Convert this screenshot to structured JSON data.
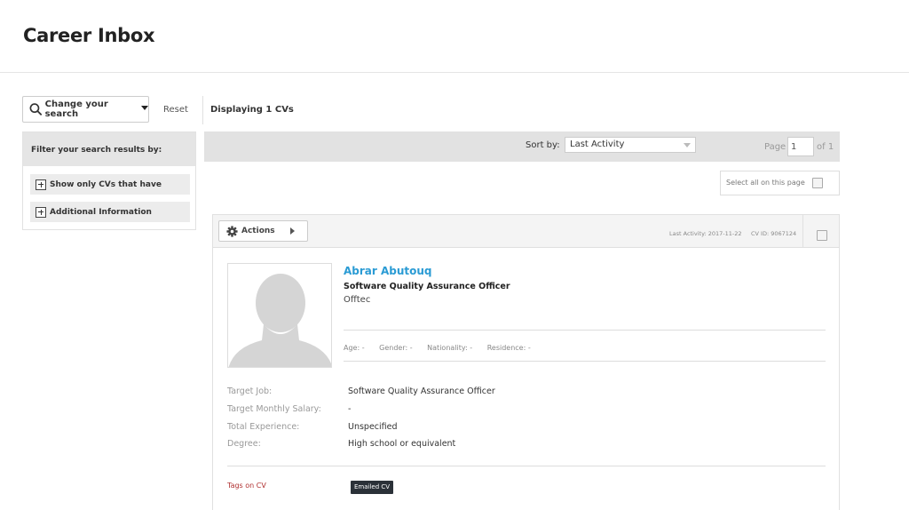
{
  "header": {
    "title": "Career Inbox"
  },
  "toolbar": {
    "change_search_label": "Change your search",
    "reset_label": "Reset",
    "displaying_text": "Displaying 1 CVs"
  },
  "filters": {
    "heading": "Filter your search results by:",
    "items": [
      {
        "label": "Show only CVs that have"
      },
      {
        "label": "Additional Information"
      }
    ]
  },
  "sort": {
    "label": "Sort by:",
    "selected": "Last Activity",
    "page_label": "Page",
    "page_value": "1",
    "page_total": "of 1"
  },
  "select_all": {
    "label": "Select all on this page",
    "checked": false
  },
  "cv": {
    "actions_label": "Actions",
    "last_activity": "Last Activity: 2017-11-22",
    "cv_id": "CV ID: 9067124",
    "name": "Abrar Abutouq",
    "title": "Software Quality Assurance Officer",
    "company": "Offtec",
    "demographics": {
      "age": "Age: -",
      "gender": "Gender: -",
      "nationality": "Nationality: -",
      "residence": "Residence: -"
    },
    "details": [
      {
        "label": "Target Job:",
        "value": "Software Quality Assurance Officer"
      },
      {
        "label": "Target Monthly Salary:",
        "value": "-"
      },
      {
        "label": "Total Experience:",
        "value": "Unspecified"
      },
      {
        "label": "Degree:",
        "value": "High school or equivalent"
      }
    ],
    "tags_label": "Tags on CV",
    "tags": [
      "Emailed CV"
    ]
  },
  "colors": {
    "link": "#2a9bd4",
    "tag_bg": "#2b3138",
    "tags_label": "#b03030",
    "bar_bg": "#e2e2e2"
  }
}
